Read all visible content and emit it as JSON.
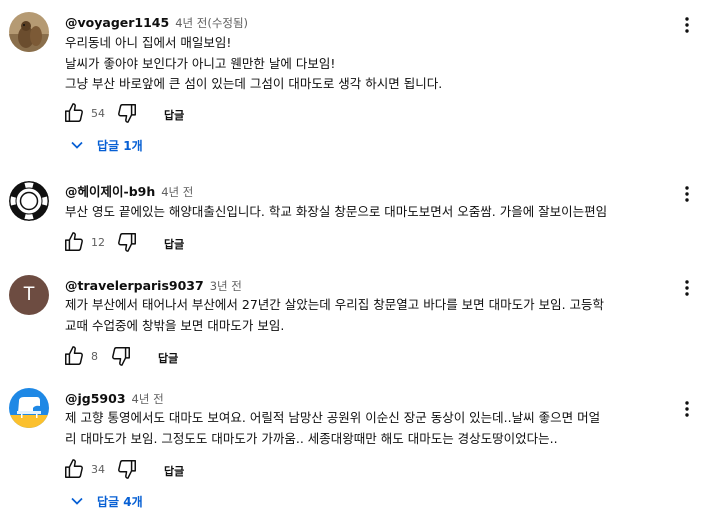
{
  "comments": [
    {
      "author": "@voyager1145",
      "time": "4년 전(수정됨)",
      "lines": [
        "우리동네 아니 집에서 매일보임!",
        "날씨가 좋아야 보인다가 아니고 웬만한 날에 다보임!",
        "그냥 부산 바로앞에 큰 섬이 있는데 그섬이 대마도로 생각 하시면 됩니다."
      ],
      "likes": "54",
      "reply_label": "답글",
      "replies_label": "답글 1개",
      "avatar_icon": "squirrel-photo-avatar"
    },
    {
      "author": "@헤이제이-b9h",
      "time": "4년 전",
      "lines": [
        "부산 영도 끝에있는 해양대출신입니다. 학교 화장실 창문으로 대마도보면서 오줌쌈. 가을에 잘보이는편임"
      ],
      "likes": "12",
      "reply_label": "답글",
      "avatar_icon": "lifebuoy-avatar"
    },
    {
      "author": "@travelerparis9037",
      "time": "3년 전",
      "lines": [
        "제가 부산에서 태어나서 부산에서 27년간 살았는데 우리집 창문열고 바다를 보면 대마도가 보임. 고등학",
        "교때 수업중에 창밖을 보면 대마도가 보임."
      ],
      "likes": "8",
      "reply_label": "답글",
      "avatar_letter": "T",
      "avatar_color": "#6d4c41"
    },
    {
      "author": "@jg5903",
      "time": "4년 전",
      "lines": [
        "제 고향 통영에서도 대마도 보여요.  어릴적 남망산 공원위 이순신 장군 동상이 있는데..날씨 좋으면 머얼",
        "리 대마도가 보임. 그정도도 대마도가 가까움.. 세종대왕때만 해도 대마도는 경상도땅이었다는.."
      ],
      "likes": "34",
      "reply_label": "답글",
      "replies_label": "답글 4개",
      "avatar_icon": "piano-logo-avatar"
    }
  ]
}
